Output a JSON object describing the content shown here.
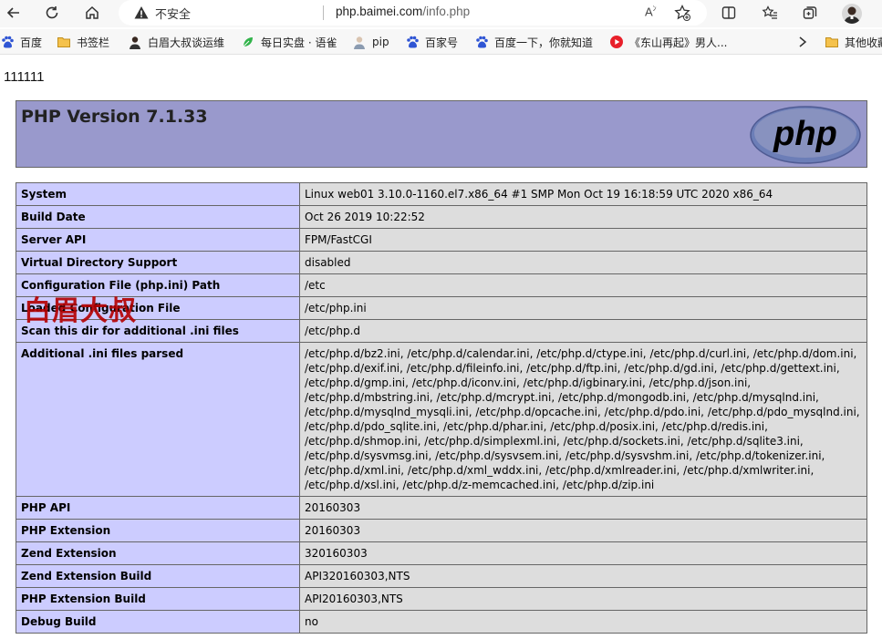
{
  "browser": {
    "security_label": "不安全",
    "url_host": "php.baimei.com",
    "url_path": "/info.php",
    "read_aloud": "A",
    "read_aloud_sup": "ﾝ"
  },
  "bookmarks": [
    {
      "label": "百度",
      "icon": "baidu-paw-icon"
    },
    {
      "label": "书签栏",
      "icon": "folder-icon"
    },
    {
      "label": "白眉大叔谈运维",
      "icon": "profile-icon"
    },
    {
      "label": "每日实盘 · 语雀",
      "icon": "leaf-icon"
    },
    {
      "label": "pip",
      "icon": "profile-icon"
    },
    {
      "label": "百家号",
      "icon": "baidu-paw-icon"
    },
    {
      "label": "百度一下，你就知道",
      "icon": "baidu-paw-icon"
    },
    {
      "label": "《东山再起》男人...",
      "icon": "play-icon"
    },
    {
      "label": "其他收藏",
      "icon": "folder-icon"
    }
  ],
  "page": {
    "output": "111111",
    "php_version_title": "PHP Version 7.1.33",
    "logo_text": "php",
    "watermark": "白眉大叔"
  },
  "rows": [
    {
      "key": "System",
      "value": "Linux web01 3.10.0-1160.el7.x86_64 #1 SMP Mon Oct 19 16:18:59 UTC 2020 x86_64"
    },
    {
      "key": "Build Date",
      "value": "Oct 26 2019 10:22:52"
    },
    {
      "key": "Server API",
      "value": "FPM/FastCGI"
    },
    {
      "key": "Virtual Directory Support",
      "value": "disabled"
    },
    {
      "key": "Configuration File (php.ini) Path",
      "value": "/etc"
    },
    {
      "key": "Loaded Configuration File",
      "value": "/etc/php.ini"
    },
    {
      "key": "Scan this dir for additional .ini files",
      "value": "/etc/php.d"
    },
    {
      "key": "Additional .ini files parsed",
      "value": "/etc/php.d/bz2.ini, /etc/php.d/calendar.ini, /etc/php.d/ctype.ini, /etc/php.d/curl.ini, /etc/php.d/dom.ini, /etc/php.d/exif.ini, /etc/php.d/fileinfo.ini, /etc/php.d/ftp.ini, /etc/php.d/gd.ini, /etc/php.d/gettext.ini, /etc/php.d/gmp.ini, /etc/php.d/iconv.ini, /etc/php.d/igbinary.ini, /etc/php.d/json.ini, /etc/php.d/mbstring.ini, /etc/php.d/mcrypt.ini, /etc/php.d/mongodb.ini, /etc/php.d/mysqlnd.ini, /etc/php.d/mysqlnd_mysqli.ini, /etc/php.d/opcache.ini, /etc/php.d/pdo.ini, /etc/php.d/pdo_mysqlnd.ini, /etc/php.d/pdo_sqlite.ini, /etc/php.d/phar.ini, /etc/php.d/posix.ini, /etc/php.d/redis.ini, /etc/php.d/shmop.ini, /etc/php.d/simplexml.ini, /etc/php.d/sockets.ini, /etc/php.d/sqlite3.ini, /etc/php.d/sysvmsg.ini, /etc/php.d/sysvsem.ini, /etc/php.d/sysvshm.ini, /etc/php.d/tokenizer.ini, /etc/php.d/xml.ini, /etc/php.d/xml_wddx.ini, /etc/php.d/xmlreader.ini, /etc/php.d/xmlwriter.ini, /etc/php.d/xsl.ini, /etc/php.d/z-memcached.ini, /etc/php.d/zip.ini"
    },
    {
      "key": "PHP API",
      "value": "20160303"
    },
    {
      "key": "PHP Extension",
      "value": "20160303"
    },
    {
      "key": "Zend Extension",
      "value": "320160303"
    },
    {
      "key": "Zend Extension Build",
      "value": "API320160303,NTS"
    },
    {
      "key": "PHP Extension Build",
      "value": "API20160303,NTS"
    },
    {
      "key": "Debug Build",
      "value": "no"
    }
  ],
  "colors": {
    "header_bg": "#9999cc",
    "key_bg": "#ccccff",
    "value_bg": "#dddddd",
    "watermark": "#b40000"
  }
}
